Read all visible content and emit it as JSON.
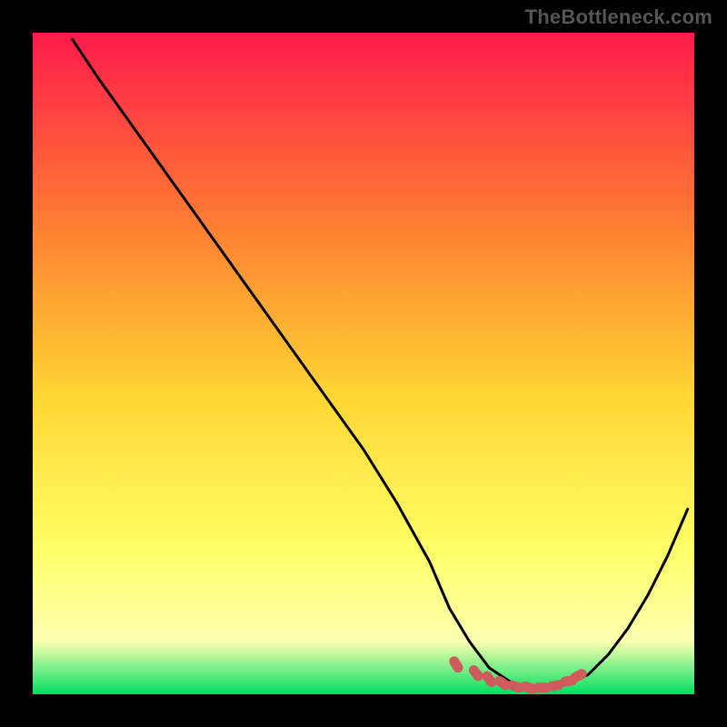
{
  "watermark": "TheBottleneck.com",
  "colors": {
    "frame_border": "#000000",
    "curve": "#000000",
    "marker_fill": "#cf5b5b",
    "marker_stroke": "#cf5b5b",
    "gradient_top": "#ff1a4b",
    "gradient_mid1": "#ff7a33",
    "gradient_mid2": "#ffd633",
    "gradient_mid3": "#ffff66",
    "gradient_bottom_yellow": "#fcffb0",
    "gradient_green": "#00e060"
  },
  "chart_data": {
    "type": "line",
    "title": "",
    "xlabel": "",
    "ylabel": "",
    "xlim": [
      0,
      100
    ],
    "ylim": [
      0,
      100
    ],
    "series": [
      {
        "name": "bottleneck-curve",
        "x": [
          6,
          10,
          15,
          20,
          25,
          30,
          35,
          40,
          45,
          50,
          55,
          60,
          63,
          66,
          69,
          72,
          75,
          78,
          81,
          84,
          87,
          90,
          93,
          96,
          99
        ],
        "y": [
          99,
          93,
          86,
          79,
          72,
          65,
          58,
          51,
          44,
          37,
          29,
          20,
          13,
          8,
          4,
          2,
          1,
          1,
          1.5,
          3,
          6,
          10,
          15,
          21,
          28
        ]
      }
    ],
    "markers": {
      "name": "optimal-range-markers",
      "x": [
        64,
        67,
        69,
        71,
        73,
        75,
        77,
        79,
        81,
        82.5
      ],
      "y": [
        4.5,
        3.2,
        2.3,
        1.7,
        1.2,
        1.0,
        1.0,
        1.3,
        2.0,
        2.8
      ]
    }
  }
}
